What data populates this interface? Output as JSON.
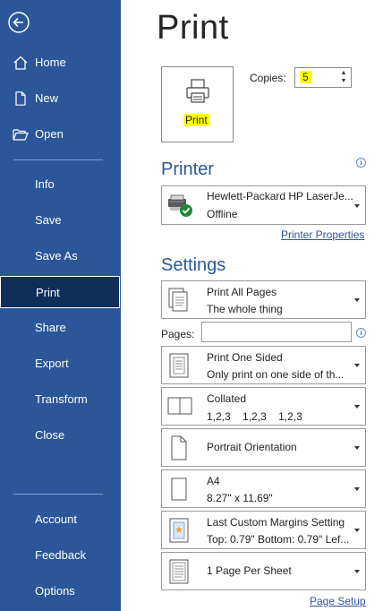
{
  "sidebar": {
    "items": [
      {
        "label": "Home",
        "icon": "home-icon"
      },
      {
        "label": "New",
        "icon": "new-document-icon"
      },
      {
        "label": "Open",
        "icon": "open-folder-icon"
      },
      {
        "label": "Info"
      },
      {
        "label": "Save"
      },
      {
        "label": "Save As"
      },
      {
        "label": "Print",
        "selected": true
      },
      {
        "label": "Share"
      },
      {
        "label": "Export"
      },
      {
        "label": "Transform"
      },
      {
        "label": "Close"
      },
      {
        "label": "Account"
      },
      {
        "label": "Feedback"
      },
      {
        "label": "Options"
      }
    ],
    "background": "#2b579a",
    "selected_background": "#0f2e5a"
  },
  "main": {
    "title": "Print",
    "print_button_label": "Print",
    "copies": {
      "label": "Copies:",
      "value": "5"
    },
    "highlight_color": "#ffff00"
  },
  "printer": {
    "section_title": "Printer",
    "name": "Hewlett-Packard HP LaserJe...",
    "status": "Offline",
    "properties_link": "Printer Properties",
    "accent": "#2b579a"
  },
  "settings": {
    "section_title": "Settings",
    "pages_label": "Pages:",
    "pages_value": "",
    "print_range": {
      "line1": "Print All Pages",
      "line2": "The whole thing"
    },
    "sides": {
      "line1": "Print One Sided",
      "line2": "Only print on one side of th..."
    },
    "collation": {
      "line1": "Collated",
      "line2": [
        "1,2,3",
        "1,2,3",
        "1,2,3"
      ]
    },
    "orientation": {
      "line1": "Portrait Orientation"
    },
    "paper": {
      "line1": "A4",
      "line2": "8.27\" x 11.69\""
    },
    "margins": {
      "line1": "Last Custom Margins Setting",
      "line2": "Top: 0.79\" Bottom: 0.79\" Lef..."
    },
    "per_sheet": {
      "line1": "1 Page Per Sheet"
    },
    "page_setup_link": "Page Setup"
  }
}
